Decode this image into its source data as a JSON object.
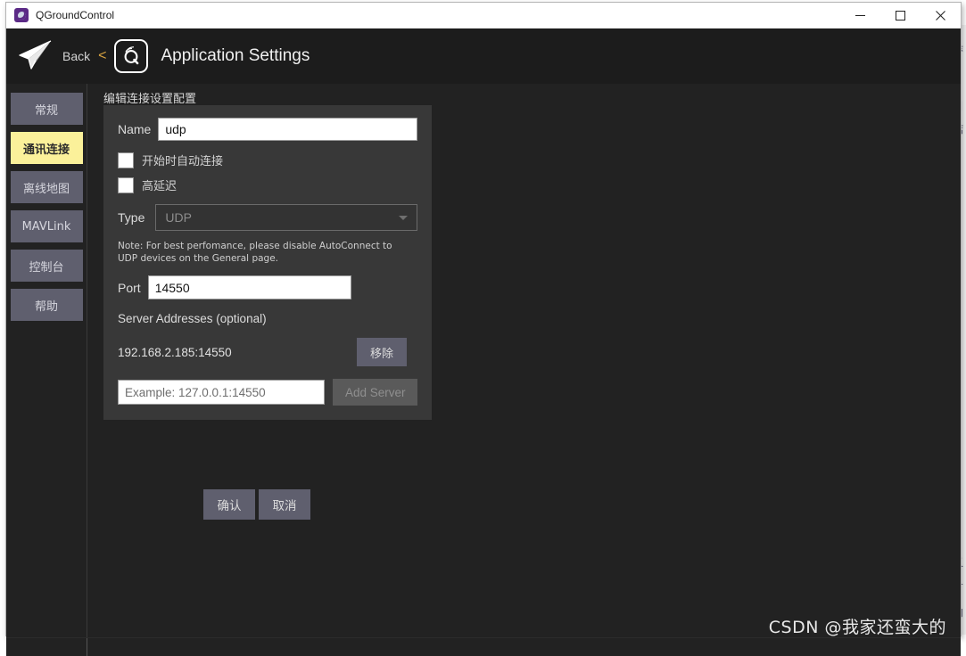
{
  "window": {
    "title": "QGroundControl",
    "app_icon": "qgc-app-icon",
    "controls": {
      "minimize": "minimize-icon",
      "maximize": "maximize-icon",
      "close": "close-icon"
    }
  },
  "header": {
    "plane_icon": "paper-plane-icon",
    "back_label": "Back",
    "back_chevron": "<",
    "badge_icon": "qgc-logo-icon",
    "page_title": "Application Settings"
  },
  "sidebar": {
    "items": [
      {
        "label": "常规",
        "active": false
      },
      {
        "label": "通讯连接",
        "active": true
      },
      {
        "label": "离线地图",
        "active": false
      },
      {
        "label": "MAVLink",
        "active": false
      },
      {
        "label": "控制台",
        "active": false
      },
      {
        "label": "帮助",
        "active": false
      }
    ]
  },
  "panel": {
    "heading": "编辑连接设置配置",
    "name": {
      "label": "Name",
      "value": "udp"
    },
    "checkboxes": [
      {
        "label": "开始时自动连接",
        "checked": false
      },
      {
        "label": "高延迟",
        "checked": false
      }
    ],
    "type": {
      "label": "Type",
      "value": "UDP",
      "caret_icon": "chevron-down-icon"
    },
    "note": "Note: For best perfomance, please disable AutoConnect to UDP devices on the General page.",
    "port": {
      "label": "Port",
      "value": "14550"
    },
    "server_section": {
      "heading": "Server Addresses (optional)",
      "entries": [
        {
          "address": "192.168.2.185:14550",
          "remove_label": "移除"
        }
      ],
      "new_server_placeholder": "Example: 127.0.0.1:14550",
      "new_server_value": "",
      "add_label": "Add Server"
    }
  },
  "actions": {
    "confirm_label": "确认",
    "cancel_label": "取消"
  },
  "watermark": "CSDN @我家还蛮大的",
  "background_fragments": [
    "悬",
    "目",
    "掂",
    "又",
    "方",
    "内"
  ],
  "colors": {
    "window_bg": "#222222",
    "panel_bg": "#383838",
    "header_bg": "#1c1c1c",
    "button_bg": "#5f5f6e",
    "active_nav": "#fbf19a",
    "accent_chevron": "#d9a441",
    "input_bg": "#ffffff"
  }
}
